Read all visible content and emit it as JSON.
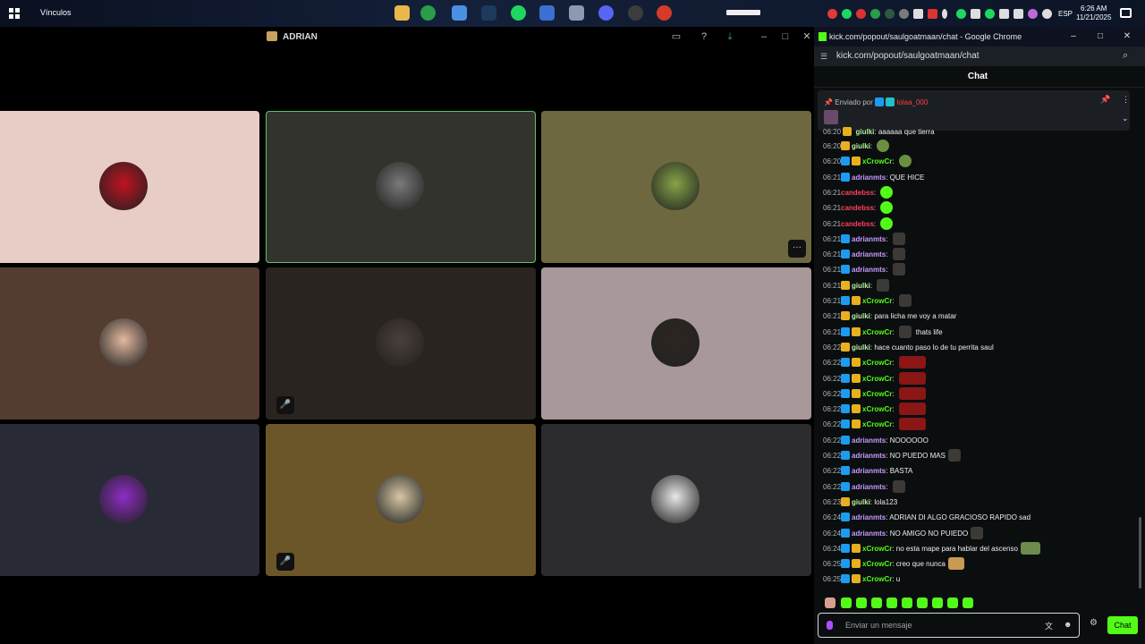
{
  "taskbar": {
    "vinculos": "Vínculos",
    "lang": "ESP",
    "time": "6:26 AM",
    "date": "11/21/2025"
  },
  "call": {
    "title": "ADRIAN",
    "tiles": [
      {
        "bg": "#e7cdc5",
        "avatar": "#c1121f",
        "active": false,
        "muted": false,
        "more": false
      },
      {
        "bg": "#33332d",
        "avatar": "#7a7a7a",
        "active": true,
        "muted": false,
        "more": false
      },
      {
        "bg": "#6d683f",
        "avatar": "#86a446",
        "active": false,
        "muted": false,
        "more": true
      },
      {
        "bg": "#553c30",
        "avatar": "#e2b9a0",
        "active": false,
        "muted": false,
        "more": false
      },
      {
        "bg": "#2a2420",
        "avatar": "#4b3f3a",
        "active": false,
        "muted": true,
        "more": false
      },
      {
        "bg": "#a8989a",
        "avatar": "#2d2620",
        "active": false,
        "muted": false,
        "more": false
      },
      {
        "bg": "#282a36",
        "avatar": "#8e2cc6",
        "active": false,
        "muted": false,
        "more": false
      },
      {
        "bg": "#6a5628",
        "avatar": "#d6c7a4",
        "active": false,
        "muted": true,
        "more": false
      },
      {
        "bg": "#2c2c2e",
        "avatar": "#e8e8e8",
        "active": false,
        "muted": false,
        "more": false
      }
    ]
  },
  "chrome": {
    "window_title": "kick.com/popout/saulgoatmaan/chat - Google Chrome",
    "url": "kick.com/popout/saulgoatmaan/chat"
  },
  "chat": {
    "header": "Chat",
    "pinned_prefix": "Enviado por",
    "pinned_user": "lolaa_000",
    "partial_top": {
      "time": "06:20",
      "user": "giulki",
      "text": "aaaaaa que tierra"
    },
    "messages": [
      {
        "time": "06:20",
        "badges": [
          "gold"
        ],
        "user": "giulki",
        "color": "#b8f0a0",
        "text": "",
        "emotes": [
          "pepe"
        ]
      },
      {
        "time": "06:20",
        "badges": [
          "blue",
          "gold"
        ],
        "user": "xCrowCr",
        "color": "#53fc18",
        "text": "",
        "emotes": [
          "pepe"
        ]
      },
      {
        "time": "06:21",
        "badges": [
          "blue"
        ],
        "user": "adrianmts",
        "color": "#c79bff",
        "text": "QUE HICE",
        "emotes": []
      },
      {
        "time": "06:21",
        "badges": [],
        "user": "candebss",
        "color": "#ff3e5e",
        "text": "",
        "emotes": [
          "green"
        ]
      },
      {
        "time": "06:21",
        "badges": [],
        "user": "candebss",
        "color": "#ff3e5e",
        "text": "",
        "emotes": [
          "green"
        ]
      },
      {
        "time": "06:21",
        "badges": [],
        "user": "candebss",
        "color": "#ff3e5e",
        "text": "",
        "emotes": [
          "green"
        ]
      },
      {
        "time": "06:21",
        "badges": [
          "blue"
        ],
        "user": "adrianmts",
        "color": "#c79bff",
        "text": "",
        "emotes": [
          "dark"
        ]
      },
      {
        "time": "06:21",
        "badges": [
          "blue"
        ],
        "user": "adrianmts",
        "color": "#c79bff",
        "text": "",
        "emotes": [
          "dark"
        ]
      },
      {
        "time": "06:21",
        "badges": [
          "blue"
        ],
        "user": "adrianmts",
        "color": "#c79bff",
        "text": "",
        "emotes": [
          "dark"
        ]
      },
      {
        "time": "06:21",
        "badges": [
          "gold"
        ],
        "user": "giulki",
        "color": "#b8f0a0",
        "text": "",
        "emotes": [
          "dark"
        ]
      },
      {
        "time": "06:21",
        "badges": [
          "blue",
          "gold"
        ],
        "user": "xCrowCr",
        "color": "#53fc18",
        "text": "",
        "emotes": [
          "dark"
        ]
      },
      {
        "time": "06:21",
        "badges": [
          "gold"
        ],
        "user": "giulki",
        "color": "#b8f0a0",
        "text": "para licha me voy a matar",
        "emotes": []
      },
      {
        "time": "06:21",
        "badges": [
          "blue",
          "gold"
        ],
        "user": "xCrowCr",
        "color": "#53fc18",
        "text": "",
        "emotes": [
          "dark"
        ],
        "after": "thats life"
      },
      {
        "time": "06:22",
        "badges": [
          "gold"
        ],
        "user": "giulki",
        "color": "#b8f0a0",
        "text": "hace cuanto paso lo de tu perrita saul",
        "emotes": []
      },
      {
        "time": "06:22",
        "badges": [
          "blue",
          "gold"
        ],
        "user": "xCrowCr",
        "color": "#53fc18",
        "text": "",
        "emotes": [
          "red"
        ]
      },
      {
        "time": "06:22",
        "badges": [
          "blue",
          "gold"
        ],
        "user": "xCrowCr",
        "color": "#53fc18",
        "text": "",
        "emotes": [
          "red"
        ]
      },
      {
        "time": "06:22",
        "badges": [
          "blue",
          "gold"
        ],
        "user": "xCrowCr",
        "color": "#53fc18",
        "text": "",
        "emotes": [
          "red"
        ]
      },
      {
        "time": "06:22",
        "badges": [
          "blue",
          "gold"
        ],
        "user": "xCrowCr",
        "color": "#53fc18",
        "text": "",
        "emotes": [
          "red"
        ]
      },
      {
        "time": "06:22",
        "badges": [
          "blue",
          "gold"
        ],
        "user": "xCrowCr",
        "color": "#53fc18",
        "text": "",
        "emotes": [
          "red"
        ]
      },
      {
        "time": "06:22",
        "badges": [
          "blue"
        ],
        "user": "adrianmts",
        "color": "#c79bff",
        "text": "NOOOOOO",
        "emotes": []
      },
      {
        "time": "06:22",
        "badges": [
          "blue"
        ],
        "user": "adrianmts",
        "color": "#c79bff",
        "text": "NO PUEDO MAS",
        "emotes": [
          "dark"
        ]
      },
      {
        "time": "06:22",
        "badges": [
          "blue"
        ],
        "user": "adrianmts",
        "color": "#c79bff",
        "text": "BASTA",
        "emotes": []
      },
      {
        "time": "06:22",
        "badges": [
          "blue"
        ],
        "user": "adrianmts",
        "color": "#c79bff",
        "text": "",
        "emotes": [
          "dark"
        ]
      },
      {
        "time": "06:23",
        "badges": [
          "gold"
        ],
        "user": "giulki",
        "color": "#b8f0a0",
        "text": "lola123",
        "emotes": []
      },
      {
        "time": "06:24",
        "badges": [
          "blue"
        ],
        "user": "adrianmts",
        "color": "#c79bff",
        "text": "ADRIAN DI ALGO GRACIOSO RAPIDO sad",
        "emotes": []
      },
      {
        "time": "06:24",
        "badges": [
          "blue"
        ],
        "user": "adrianmts",
        "color": "#c79bff",
        "text": "NO AMIGO NO PUIEDO",
        "emotes": [
          "dark"
        ]
      },
      {
        "time": "06:24",
        "badges": [
          "blue",
          "gold"
        ],
        "user": "xCrowCr",
        "color": "#53fc18",
        "text": "no esta mape para hablar del ascenso",
        "emotes": [
          "img"
        ]
      },
      {
        "time": "06:25",
        "badges": [
          "blue",
          "gold"
        ],
        "user": "xCrowCr",
        "color": "#53fc18",
        "text": "creo que nunca",
        "emotes": [
          "cat"
        ]
      },
      {
        "time": "06:25",
        "badges": [
          "blue",
          "gold"
        ],
        "user": "xCrowCr",
        "color": "#53fc18",
        "text": "u",
        "emotes": []
      }
    ],
    "input_placeholder": "Enviar un mensaje",
    "send_label": "Chat"
  }
}
